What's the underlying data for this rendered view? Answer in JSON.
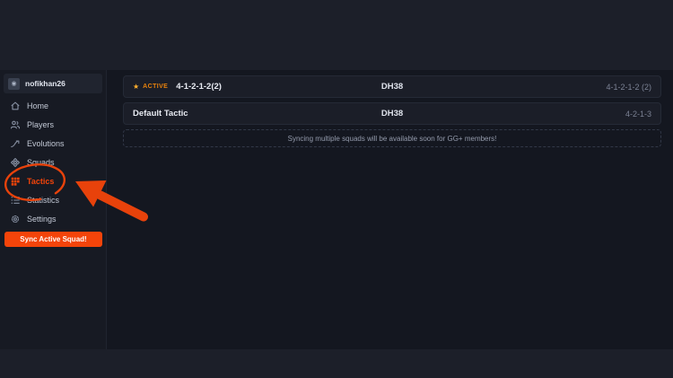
{
  "sidebar": {
    "username": "nofikhan26",
    "items": [
      {
        "label": "Home",
        "icon": "home-icon"
      },
      {
        "label": "Players",
        "icon": "players-icon"
      },
      {
        "label": "Evolutions",
        "icon": "evolutions-icon"
      },
      {
        "label": "Squads",
        "icon": "squads-icon"
      },
      {
        "label": "Tactics",
        "icon": "tactics-icon",
        "active": true
      },
      {
        "label": "Statistics",
        "icon": "statistics-icon"
      },
      {
        "label": "Settings",
        "icon": "settings-icon"
      }
    ],
    "sync_button_label": "Sync Active Squad!"
  },
  "tactics": {
    "rows": [
      {
        "active": true,
        "star_icon": "★",
        "active_label": "ACTIVE",
        "name": "4-1-2-1-2(2)",
        "code": "DH38",
        "formation": "4-1-2-1-2 (2)"
      },
      {
        "active": false,
        "name": "Default Tactic",
        "code": "DH38",
        "formation": "4-2-1-3"
      }
    ],
    "notice": "Syncing multiple squads will be available soon for GG+ members!"
  },
  "colors": {
    "accent": "#f4440a",
    "annotation": "#e8420b",
    "star": "#ffb02e",
    "active_badge": "#e8820c",
    "page_band": "#1c1f29",
    "sidebar_bg": "#171a23",
    "content_bg": "#141720",
    "card_bg": "#1b1e28"
  }
}
